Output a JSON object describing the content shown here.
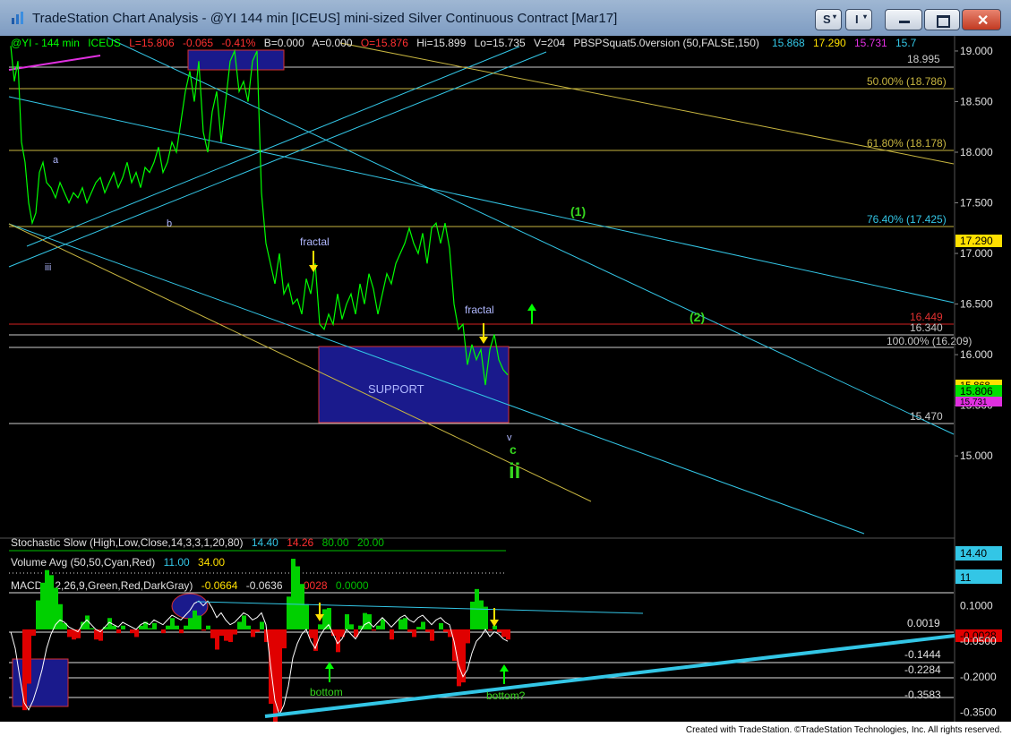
{
  "window": {
    "title": "TradeStation Chart Analysis - @YI 144 min [ICEUS] mini-sized Silver Continuous Contract [Mar17]",
    "buttons": {
      "s": "S",
      "i": "I"
    },
    "footer": "Created with TradeStation. ©TradeStation Technologies, Inc. All rights reserved."
  },
  "colors": {
    "background": "#000000",
    "price": "#00ff00",
    "channel": "#33c6e6",
    "support_box": "#1a1a8c",
    "fib": "#c8b640",
    "label_green": "#36d61e",
    "label_yellow": "#ffe000",
    "macd_pos": "#00d000",
    "macd_neg": "#e00000"
  },
  "header": {
    "symbol": "@YI - 144 min",
    "exchange": "ICEUS",
    "last": "L=15.806",
    "change": "-0.065",
    "pct": "-0.41%",
    "bid": "B=0.000",
    "ask": "A=0.000",
    "open": "O=15.876",
    "high": "Hi=15.899",
    "low": "Lo=15.735",
    "volume": "V=204",
    "study": "PBSPSquat5.0version (50,FALSE,150)",
    "v1": "15.868",
    "v2": "17.290",
    "v3": "15.731",
    "v4": "15.7"
  },
  "chart_data": [
    {
      "type": "line",
      "name": "price",
      "ylim": [
        14.55,
        19.15
      ],
      "ticks": [
        "19.000",
        "18.500",
        "18.000",
        "17.500",
        "17.000",
        "16.500",
        "16.000",
        "15.500",
        "15.000"
      ],
      "tick_values": [
        19.0,
        18.5,
        18.0,
        17.5,
        17.0,
        16.5,
        16.0,
        15.5,
        15.0
      ],
      "x": [
        0,
        4,
        8,
        12,
        16,
        20,
        24,
        28,
        32,
        36,
        40,
        45,
        50,
        55,
        60,
        65,
        70,
        75,
        80,
        85,
        90,
        95,
        100,
        105,
        110,
        115,
        120,
        125,
        130,
        135,
        140,
        145,
        150,
        155,
        160,
        165,
        170,
        175,
        180,
        185,
        190,
        195,
        200,
        205,
        210,
        215,
        220,
        225,
        230,
        235,
        240,
        245,
        250,
        255,
        260,
        265,
        270,
        275,
        280,
        285,
        290,
        295,
        300,
        305,
        310,
        315,
        320,
        325,
        330,
        335,
        340,
        345,
        350,
        355,
        360,
        365,
        370,
        375,
        380,
        385,
        390,
        395,
        400,
        405,
        410,
        415,
        420,
        425,
        430,
        435,
        440,
        445,
        450,
        455,
        460,
        465,
        470,
        475,
        480,
        485,
        490,
        495,
        500,
        505,
        510,
        515,
        520,
        525,
        530,
        535,
        540,
        545,
        550,
        555
      ],
      "y": [
        19.05,
        18.7,
        18.9,
        18.1,
        17.9,
        17.5,
        17.3,
        17.4,
        17.8,
        17.9,
        17.7,
        17.65,
        17.55,
        17.7,
        17.6,
        17.5,
        17.6,
        17.55,
        17.65,
        17.5,
        17.6,
        17.7,
        17.75,
        17.6,
        17.7,
        17.8,
        17.65,
        17.75,
        17.9,
        17.7,
        17.8,
        17.65,
        17.85,
        17.8,
        17.9,
        18.05,
        17.8,
        17.9,
        18.1,
        18.0,
        18.3,
        18.6,
        18.8,
        18.5,
        18.9,
        18.2,
        18.0,
        18.4,
        18.6,
        18.1,
        18.5,
        18.9,
        19.0,
        18.6,
        18.7,
        18.5,
        18.9,
        19.0,
        17.6,
        17.1,
        16.9,
        16.7,
        17.0,
        16.6,
        16.7,
        16.5,
        16.55,
        16.4,
        16.75,
        16.6,
        16.9,
        16.3,
        16.25,
        16.4,
        16.3,
        16.6,
        16.35,
        16.5,
        16.6,
        16.4,
        16.7,
        16.5,
        16.8,
        16.65,
        16.4,
        16.6,
        16.8,
        16.7,
        16.9,
        17.0,
        17.1,
        17.25,
        17.1,
        17.0,
        17.2,
        16.9,
        17.25,
        17.3,
        17.1,
        17.3,
        17.05,
        16.5,
        16.25,
        16.3,
        15.9,
        16.1,
        15.95,
        16.05,
        15.7,
        16.05,
        16.2,
        15.95,
        15.85,
        15.8
      ]
    },
    {
      "type": "line",
      "name": "macd",
      "ylim": [
        -0.39,
        0.155
      ],
      "ticks": [
        "0.1000",
        "-0.0500",
        "-0.2000",
        "-0.3500"
      ],
      "tick_values": [
        0.1,
        -0.05,
        -0.2,
        -0.35
      ],
      "x": [
        0,
        5,
        10,
        15,
        20,
        25,
        30,
        35,
        40,
        45,
        50,
        55,
        60,
        65,
        70,
        75,
        80,
        85,
        90,
        95,
        100,
        105,
        110,
        115,
        120,
        125,
        130,
        135,
        140,
        145,
        150,
        155,
        160,
        165,
        170,
        175,
        180,
        185,
        190,
        195,
        200,
        205,
        210,
        215,
        220,
        225,
        230,
        235,
        240,
        245,
        250,
        255,
        260,
        265,
        270,
        275,
        280,
        285,
        290,
        295,
        300,
        305,
        310,
        315,
        320,
        325,
        330,
        335,
        340,
        345,
        350,
        355,
        360,
        365,
        370,
        375,
        380,
        385,
        390,
        395,
        400,
        405,
        410,
        415,
        420,
        425,
        430,
        435,
        440,
        445,
        450,
        455,
        460,
        465,
        470,
        475,
        480,
        485,
        490,
        495,
        500,
        505,
        510,
        515,
        520,
        525,
        530,
        535,
        540,
        545,
        550,
        555
      ],
      "y": [
        -0.01,
        -0.08,
        -0.2,
        -0.31,
        -0.34,
        -0.3,
        -0.24,
        -0.17,
        -0.08,
        -0.02,
        0.02,
        0.04,
        0.03,
        0.01,
        0.0,
        -0.01,
        0.02,
        0.04,
        0.02,
        0.0,
        -0.01,
        0.01,
        0.03,
        0.02,
        0.01,
        0.03,
        0.02,
        0.01,
        0.0,
        0.02,
        0.03,
        0.02,
        0.04,
        0.03,
        0.02,
        0.04,
        0.06,
        0.05,
        0.04,
        0.06,
        0.08,
        0.11,
        0.12,
        0.1,
        0.12,
        0.09,
        0.05,
        0.07,
        0.04,
        0.02,
        0.03,
        0.05,
        0.07,
        0.06,
        0.04,
        0.05,
        0.07,
        0.02,
        -0.15,
        -0.3,
        -0.36,
        -0.32,
        -0.24,
        -0.12,
        -0.06,
        -0.02,
        0.0,
        -0.05,
        -0.08,
        -0.03,
        0.0,
        0.02,
        -0.02,
        -0.06,
        -0.04,
        0.0,
        -0.02,
        -0.04,
        -0.01,
        0.02,
        0.03,
        0.01,
        0.03,
        0.05,
        0.03,
        0.01,
        0.03,
        0.05,
        0.06,
        0.04,
        0.03,
        0.05,
        0.06,
        0.04,
        0.02,
        0.04,
        0.05,
        0.03,
        0.02,
        -0.05,
        -0.15,
        -0.2,
        -0.17,
        -0.1,
        -0.05,
        -0.03,
        0.0,
        -0.03,
        -0.01,
        -0.02,
        -0.04,
        -0.05
      ]
    }
  ],
  "price_levels": {
    "l_18995": "18.995",
    "l_16340": "16.340",
    "l_15470": "15.470",
    "fib_50": "50.00% (18.786)",
    "fib_618": "61.80% (18.178)",
    "fib_764": "76.40% (17.425)",
    "fib_100": "100.00% (16.209)",
    "red": "16.449"
  },
  "price_flags": {
    "f1": "17.290",
    "f2": "15.868",
    "f3": "15.806",
    "f4": "15.731"
  },
  "labels": {
    "a": "a",
    "b": "b",
    "iii": "iii",
    "fractal1": "fractal",
    "fractal2": "fractal",
    "support": "SUPPORT",
    "v": "v",
    "c": "c",
    "ii": "ii",
    "one": "(1)",
    "two": "(2)",
    "bottom1": "bottom",
    "bottom2": "bottom?"
  },
  "stoch": {
    "name": "Stochastic Slow (High,Low,Close,14,3,3,1,20,80)",
    "v1": "14.40",
    "v2": "14.26",
    "v3": "80.00",
    "v4": "20.00",
    "flag": "14.40"
  },
  "volume": {
    "name": "Volume Avg (50,50,Cyan,Red)",
    "v1": "11.00",
    "v2": "34.00",
    "flag": "11"
  },
  "macd": {
    "name": "MACD (12,26,9,Green,Red,DarkGray)",
    "v1": "-0.0664",
    "v2": "-0.0636",
    "v3": "-0.0028",
    "v4": "0.0000",
    "lvl_0019": "0.0019",
    "lvl_1444": "-0.1444",
    "lvl_2284": "-0.2284",
    "lvl_3583": "-0.3583",
    "flag": "-0.0028"
  }
}
